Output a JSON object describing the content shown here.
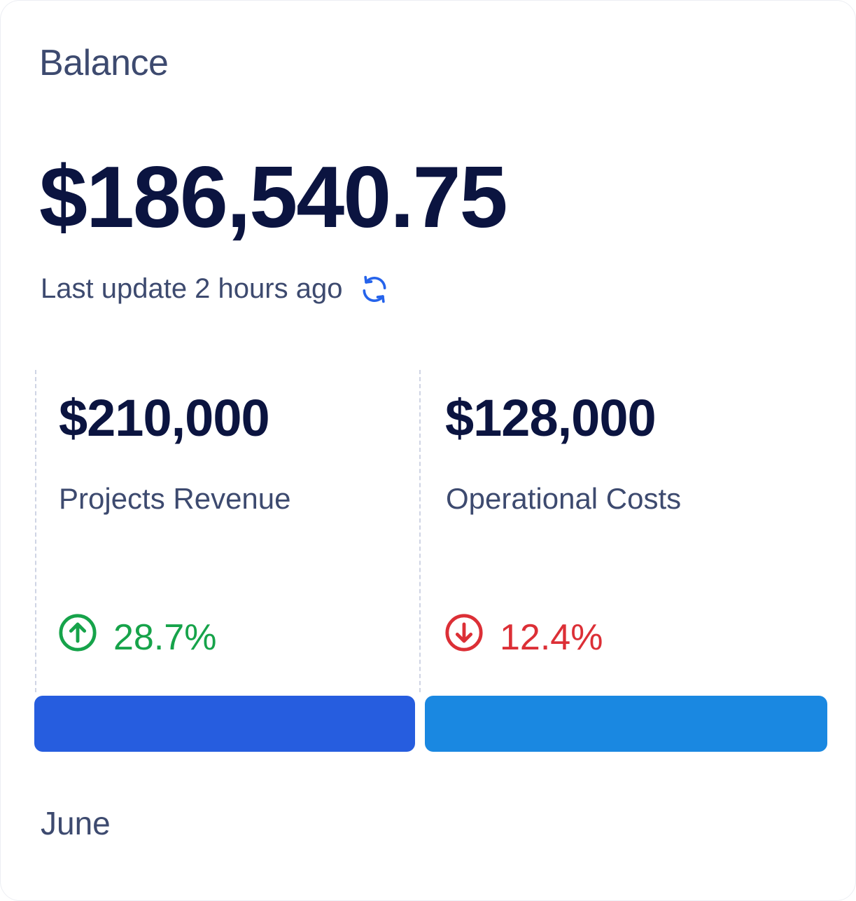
{
  "card": {
    "title": "Balance",
    "balance": "$186,540.75",
    "last_update": "Last update 2 hours ago",
    "refresh_icon": "refresh-icon"
  },
  "stats": [
    {
      "value": "$210,000",
      "label": "Projects Revenue",
      "change": "28.7%",
      "direction": "up",
      "color": "#16a34a",
      "bar_color": "#265ddf"
    },
    {
      "value": "$128,000",
      "label": "Operational Costs",
      "change": "12.4%",
      "direction": "down",
      "color": "#dc2f36",
      "bar_color": "#1a88e1"
    }
  ],
  "month": "June",
  "colors": {
    "text_primary": "#0b1440",
    "text_secondary": "#3d4a6f",
    "accent": "#2563eb"
  }
}
